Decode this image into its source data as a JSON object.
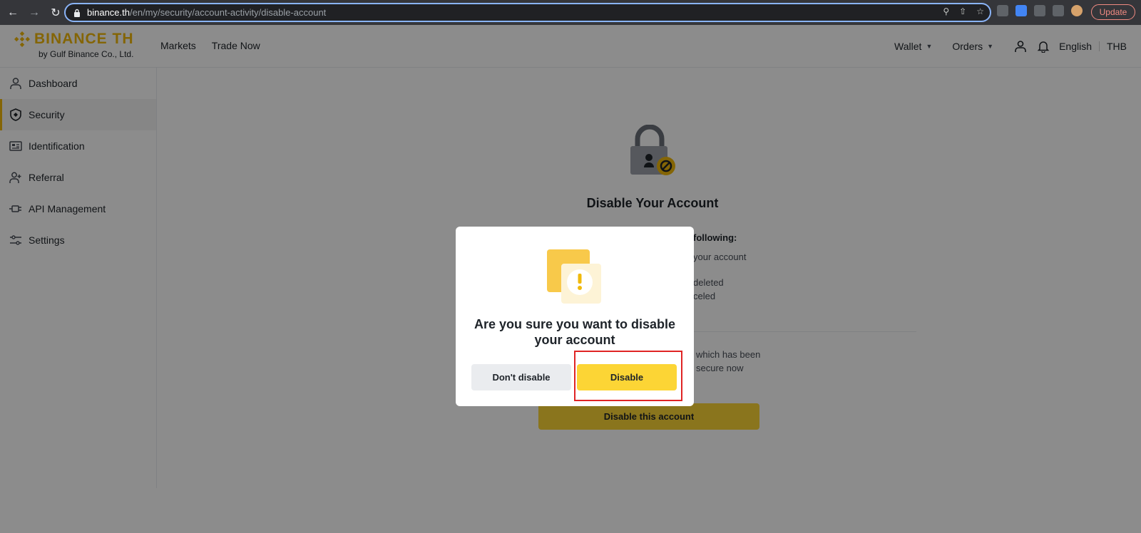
{
  "browser": {
    "url_host": "binance.th",
    "url_path": "/en/my/security/account-activity/disable-account",
    "update_label": "Update"
  },
  "header": {
    "logo_main": "BINANCE TH",
    "logo_sub": "by Gulf Binance Co., Ltd.",
    "nav": [
      "Markets",
      "Trade Now"
    ],
    "wallet_label": "Wallet",
    "orders_label": "Orders",
    "language": "English",
    "currency": "THB"
  },
  "sidebar": {
    "items": [
      {
        "label": "Dashboard",
        "icon": "user-icon"
      },
      {
        "label": "Security",
        "icon": "shield-icon"
      },
      {
        "label": "Identification",
        "icon": "id-card-icon"
      },
      {
        "label": "Referral",
        "icon": "add-user-icon"
      },
      {
        "label": "API Management",
        "icon": "api-plug-icon"
      },
      {
        "label": "Settings",
        "icon": "sliders-icon"
      }
    ],
    "active_index": 1
  },
  "main": {
    "title": "Disable Your Account",
    "info_heading": "following:",
    "info_lines": [
      "your account",
      "deleted",
      "celed",
      "which has been",
      "secure now"
    ],
    "disable_account_label": "Disable this account"
  },
  "modal": {
    "title": "Are you sure you want to disable your account",
    "cancel_label": "Don't disable",
    "confirm_label": "Disable"
  },
  "colors": {
    "brand": "#f0b90b",
    "button_primary": "#fcd535",
    "highlight": "#e02424"
  }
}
